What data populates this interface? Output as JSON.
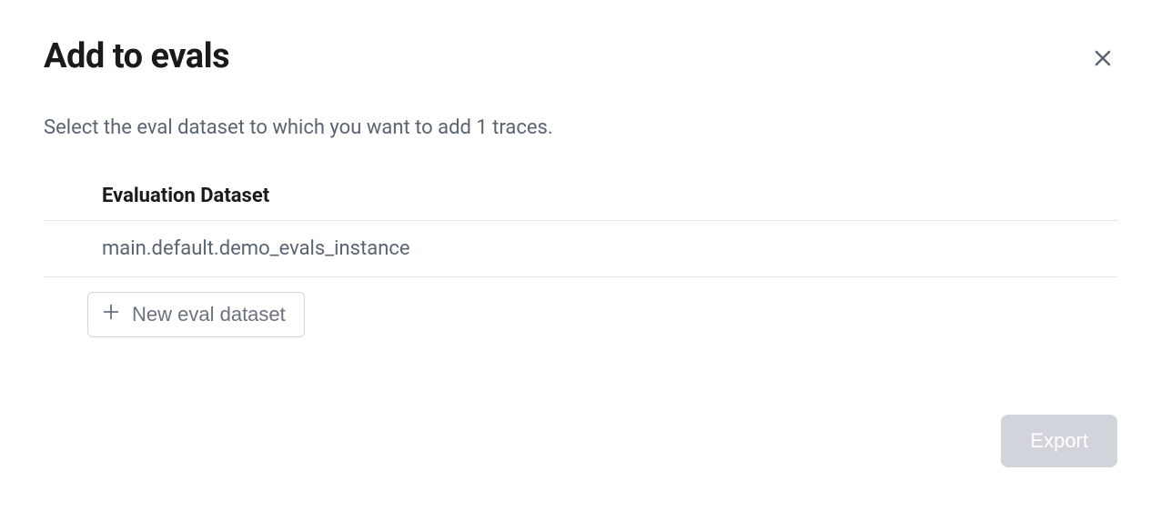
{
  "modal": {
    "title": "Add to evals",
    "description": "Select the eval dataset to which you want to add 1 traces.",
    "table": {
      "header": "Evaluation Dataset",
      "rows": [
        {
          "name": "main.default.demo_evals_instance"
        }
      ]
    },
    "new_dataset_label": "New eval dataset",
    "export_label": "Export"
  }
}
